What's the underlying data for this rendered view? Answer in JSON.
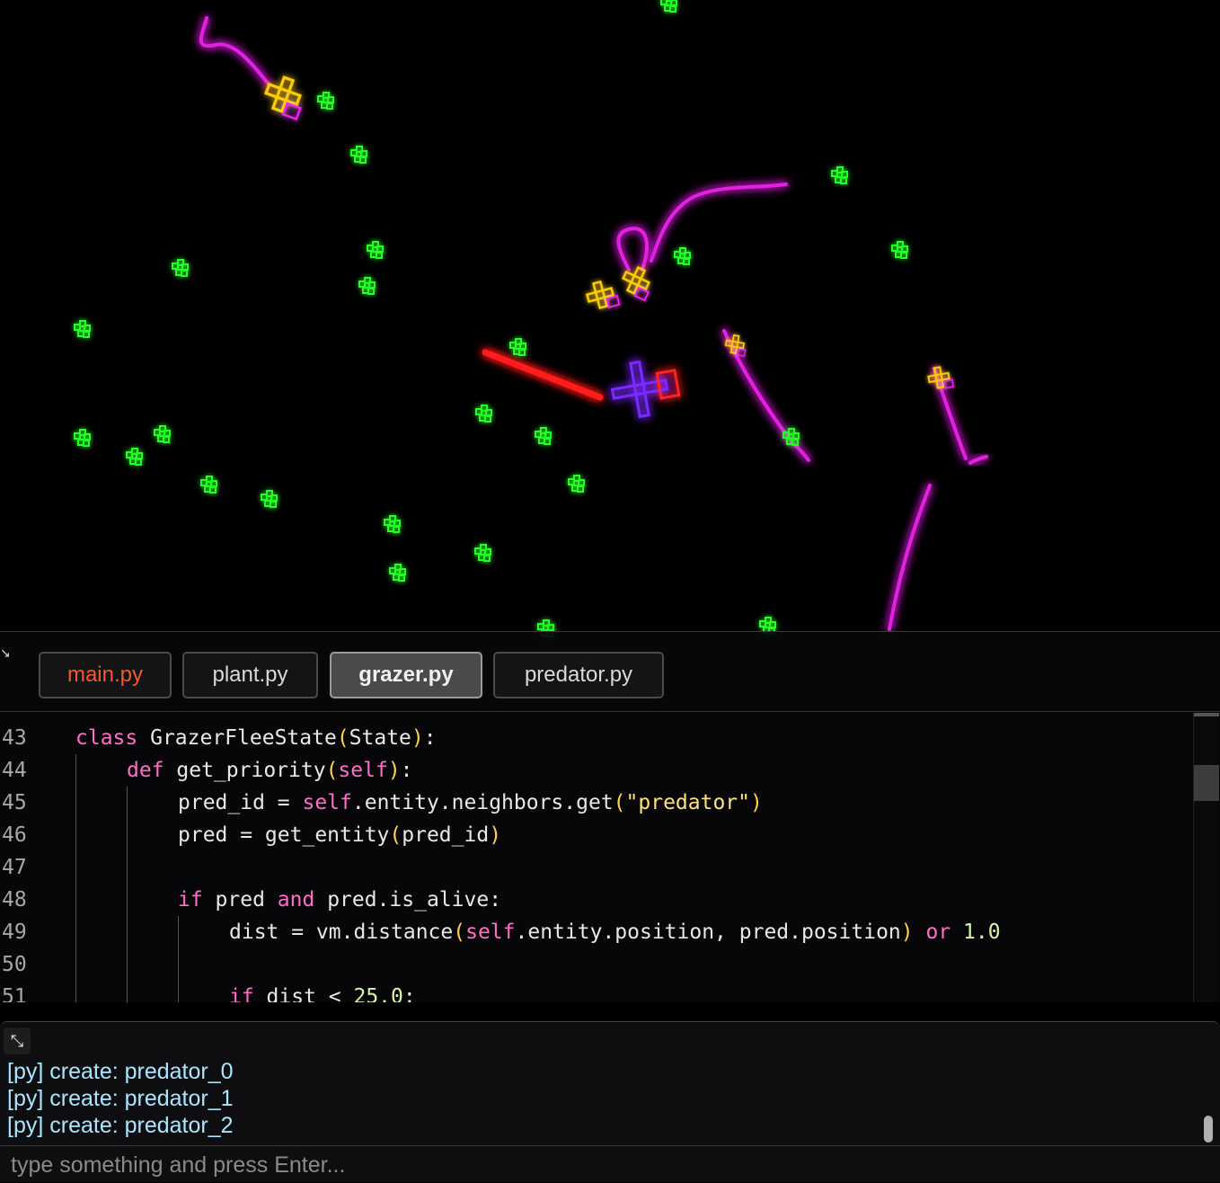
{
  "colors": {
    "plant": "#22ff22",
    "trail": "#ee22ee",
    "grazer": "#ffcc11",
    "attack_trail": "#ff1a1a",
    "predator": "#7a2cff",
    "predator_accent": "#ff2222"
  },
  "editor": {
    "collapse_icon": "↘",
    "tabs": [
      {
        "label": "main.py",
        "state": "modified"
      },
      {
        "label": "plant.py",
        "state": "normal"
      },
      {
        "label": "grazer.py",
        "state": "active"
      },
      {
        "label": "predator.py",
        "state": "normal"
      }
    ],
    "lines": [
      {
        "n": "43",
        "indent": 0,
        "tokens": [
          [
            "kw",
            "class"
          ],
          [
            "t",
            " GrazerFleeState"
          ],
          [
            "paren",
            "("
          ],
          [
            "t",
            "State"
          ],
          [
            "paren",
            ")"
          ],
          [
            "t",
            ":"
          ]
        ]
      },
      {
        "n": "44",
        "indent": 1,
        "tokens": [
          [
            "kw",
            "def"
          ],
          [
            "t",
            " get_priority"
          ],
          [
            "paren",
            "("
          ],
          [
            "self",
            "self"
          ],
          [
            "paren",
            ")"
          ],
          [
            "t",
            ":"
          ]
        ]
      },
      {
        "n": "45",
        "indent": 2,
        "tokens": [
          [
            "t",
            "pred_id = "
          ],
          [
            "self",
            "self"
          ],
          [
            "t",
            ".entity.neighbors.get"
          ],
          [
            "paren",
            "("
          ],
          [
            "str",
            "\"predator\""
          ],
          [
            "paren",
            ")"
          ]
        ]
      },
      {
        "n": "46",
        "indent": 2,
        "tokens": [
          [
            "t",
            "pred = get_entity"
          ],
          [
            "paren",
            "("
          ],
          [
            "t",
            "pred_id"
          ],
          [
            "paren",
            ")"
          ]
        ]
      },
      {
        "n": "47",
        "indent": 2,
        "tokens": []
      },
      {
        "n": "48",
        "indent": 2,
        "tokens": [
          [
            "kw",
            "if"
          ],
          [
            "t",
            " pred "
          ],
          [
            "kw",
            "and"
          ],
          [
            "t",
            " pred.is_alive:"
          ]
        ]
      },
      {
        "n": "49",
        "indent": 3,
        "tokens": [
          [
            "t",
            "dist = vm.distance"
          ],
          [
            "paren",
            "("
          ],
          [
            "self",
            "self"
          ],
          [
            "t",
            ".entity.position, pred.position"
          ],
          [
            "paren",
            ")"
          ],
          [
            "t",
            " "
          ],
          [
            "kw",
            "or"
          ],
          [
            "t",
            " "
          ],
          [
            "num",
            "1.0"
          ]
        ]
      },
      {
        "n": "50",
        "indent": 3,
        "tokens": []
      },
      {
        "n": "51",
        "indent": 3,
        "tokens": [
          [
            "kw",
            "if"
          ],
          [
            "t",
            " dist < "
          ],
          [
            "num",
            "25.0"
          ],
          [
            "t",
            ":"
          ]
        ]
      }
    ]
  },
  "console": {
    "expand_icon": "⤡",
    "log": [
      "[py] create: predator_0",
      "[py] create: predator_1",
      "[py] create: predator_2"
    ],
    "input_placeholder": "type something and press Enter...",
    "input_value": ""
  }
}
